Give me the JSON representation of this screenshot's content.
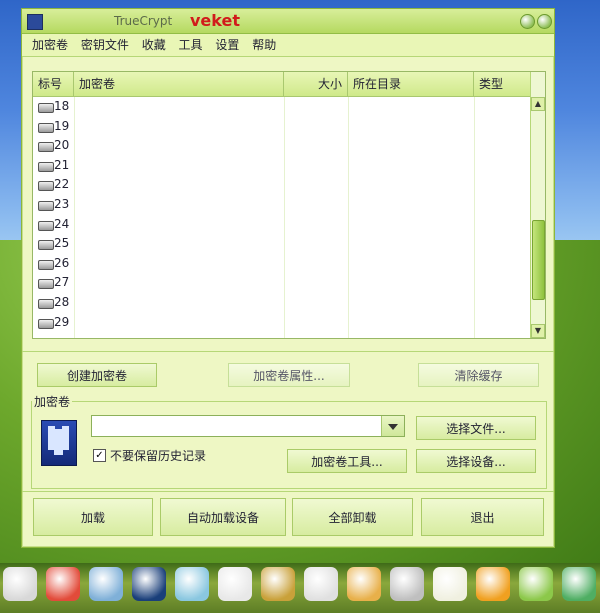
{
  "window": {
    "title": "TrueCrypt",
    "brand": "veket"
  },
  "menu": [
    "加密卷",
    "密钥文件",
    "收藏",
    "工具",
    "设置",
    "帮助"
  ],
  "table": {
    "headers": [
      "标号",
      "加密卷",
      "大小",
      "所在目录",
      "类型"
    ],
    "rows": [
      "18",
      "19",
      "20",
      "21",
      "22",
      "23",
      "24",
      "25",
      "26",
      "27",
      "28",
      "29"
    ]
  },
  "actions": {
    "create": "创建加密卷",
    "properties": "加密卷属性...",
    "wipe_cache": "清除缓存"
  },
  "volume": {
    "label": "加密卷",
    "path_value": "",
    "never_save_history_label": "不要保留历史记录",
    "never_save_history_checked": true,
    "select_file": "选择文件...",
    "volume_tools": "加密卷工具...",
    "select_device": "选择设备..."
  },
  "bottom": {
    "mount": "加载",
    "auto_mount": "自动加载设备",
    "dismount_all": "全部卸载",
    "exit": "退出"
  },
  "taskbar_icons": [
    "tux-icon",
    "cat-icon",
    "chart-icon",
    "media-player-icon",
    "search-people-icon",
    "penguin-icon",
    "notebook-icon",
    "image-viewer-icon",
    "paint-palette-icon",
    "usb-drive-icon",
    "text-editor-icon",
    "tiger-icon",
    "package-icon",
    "camera-icon"
  ]
}
